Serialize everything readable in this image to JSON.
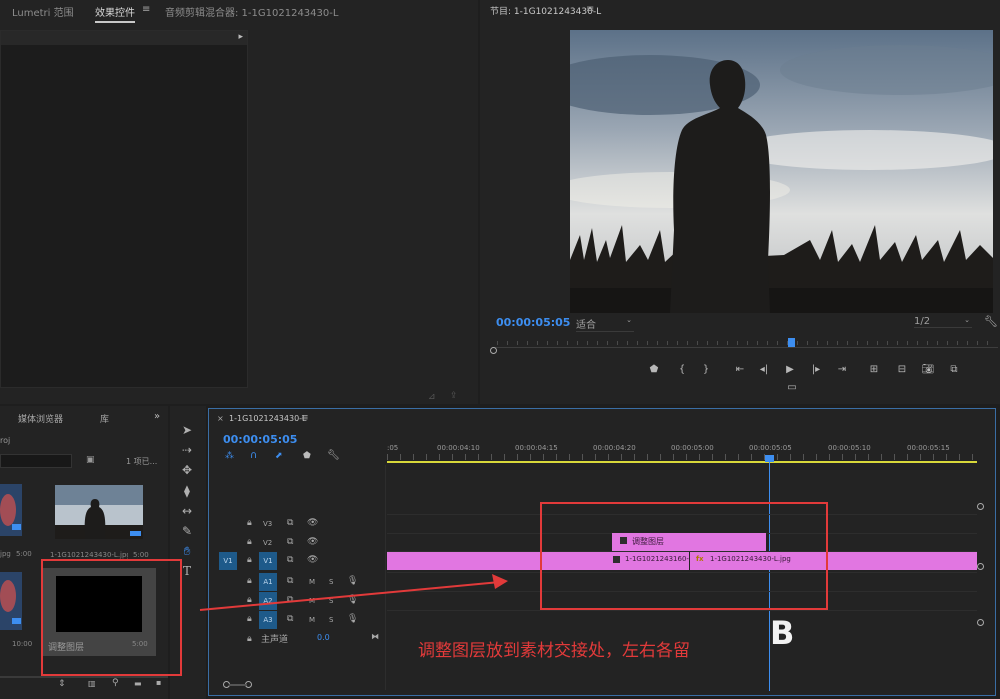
{
  "effects_panel": {
    "tabs": [
      "Lumetri 范围",
      "效果控件",
      "音频剪辑混合器: 1-1G1021243430-L"
    ],
    "menu_glyph": "≡"
  },
  "program_monitor": {
    "title": "节目: 1-1G1021243430-L",
    "menu_glyph": "≡",
    "timecode": "00:00:05:05",
    "fit_label": "适合",
    "resolution": "1/2"
  },
  "project": {
    "tabs": [
      "媒体浏览器",
      "库"
    ],
    "overflow": "»",
    "partial_label": "roj",
    "items_count": "1 项已...",
    "thumbs": [
      {
        "name": "1-1G1021243430-L.jpg",
        "duration": "5:00"
      },
      {
        "name": "调整图层",
        "duration": "5:00"
      }
    ],
    "left_partial": [
      {
        "name": "jpg",
        "duration": "5:00"
      },
      {
        "name": "",
        "duration": "10:00"
      }
    ]
  },
  "timeline": {
    "sequence_name": "1-1G1021243430-L",
    "menu_glyph": "≡",
    "timecode": "00:00:05:05",
    "ruler_labels": [
      ":05",
      "00:00:04:10",
      "00:00:04:15",
      "00:00:04:20",
      "00:00:05:00",
      "00:00:05:05",
      "00:00:05:10",
      "00:00:05:15"
    ],
    "video_tracks": [
      "V3",
      "V2",
      "V1"
    ],
    "source_patch": "V1",
    "audio_tracks": [
      "A1",
      "A2",
      "A3"
    ],
    "master_label": "主声道",
    "master_value": "0.0",
    "clips": {
      "v2_adjustment": "调整图层",
      "v1_left": "1-1G1021243160-L.jpg",
      "v1_right_fx": "fx",
      "v1_right": "1-1G1021243430-L.jpg"
    },
    "mute_label": "M",
    "solo_label": "S"
  },
  "annotation": {
    "text": "调整图层放到素材交接处，左右各留",
    "color": "#e23a3a"
  },
  "watermark": "B"
}
